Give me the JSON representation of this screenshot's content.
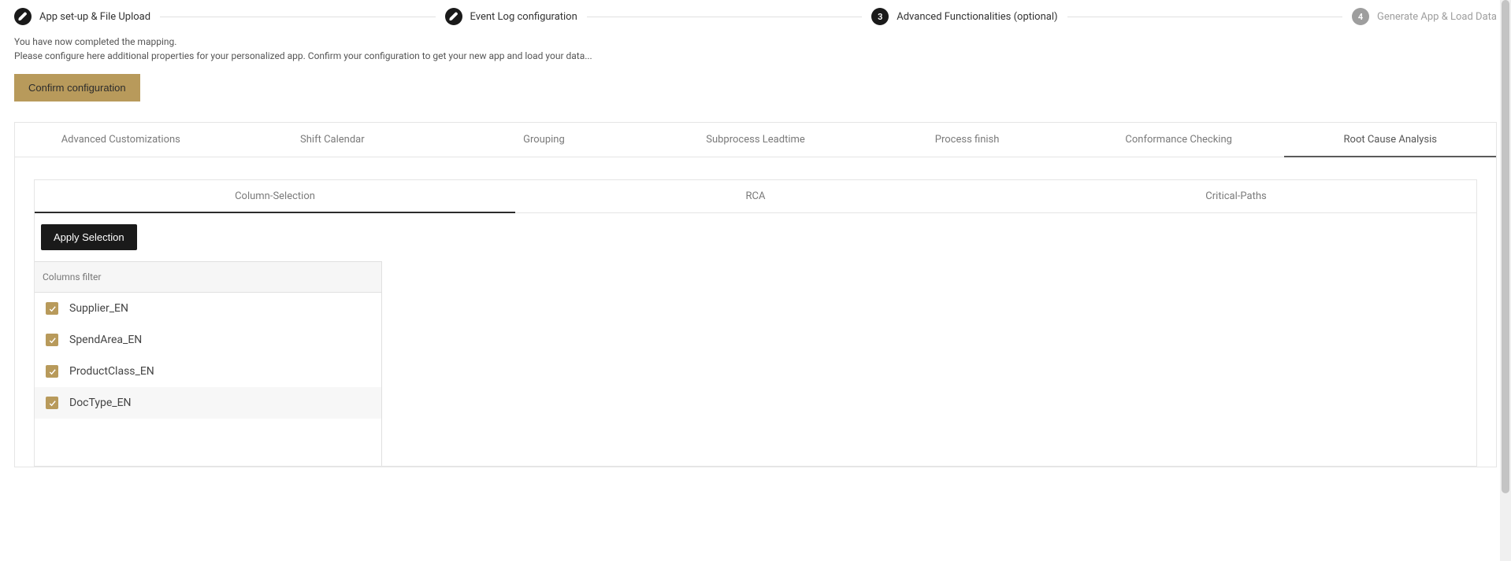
{
  "stepper": {
    "steps": [
      {
        "label": "App set-up & File Upload",
        "state": "done"
      },
      {
        "label": "Event Log configuration",
        "state": "done"
      },
      {
        "label": "Advanced Functionalities (optional)",
        "state": "current",
        "number": "3"
      },
      {
        "label": "Generate App & Load Data",
        "state": "upcoming",
        "number": "4"
      }
    ]
  },
  "intro": {
    "line1": "You have now completed the mapping.",
    "line2": "Please configure here additional properties for your personalized app. Confirm your configuration to get your new app and load your data..."
  },
  "buttons": {
    "confirm": "Confirm configuration",
    "apply": "Apply Selection"
  },
  "tabs_outer": [
    "Advanced Customizations",
    "Shift Calendar",
    "Grouping",
    "Subprocess Leadtime",
    "Process finish",
    "Conformance Checking",
    "Root Cause Analysis"
  ],
  "tabs_outer_active": 6,
  "tabs_inner": [
    "Column-Selection",
    "RCA",
    "Critical-Paths"
  ],
  "tabs_inner_active": 0,
  "columns": {
    "header": "Columns filter",
    "items": [
      {
        "label": "Supplier_EN",
        "checked": true,
        "selected": false
      },
      {
        "label": "SpendArea_EN",
        "checked": true,
        "selected": false
      },
      {
        "label": "ProductClass_EN",
        "checked": true,
        "selected": false
      },
      {
        "label": "DocType_EN",
        "checked": true,
        "selected": true
      }
    ]
  }
}
